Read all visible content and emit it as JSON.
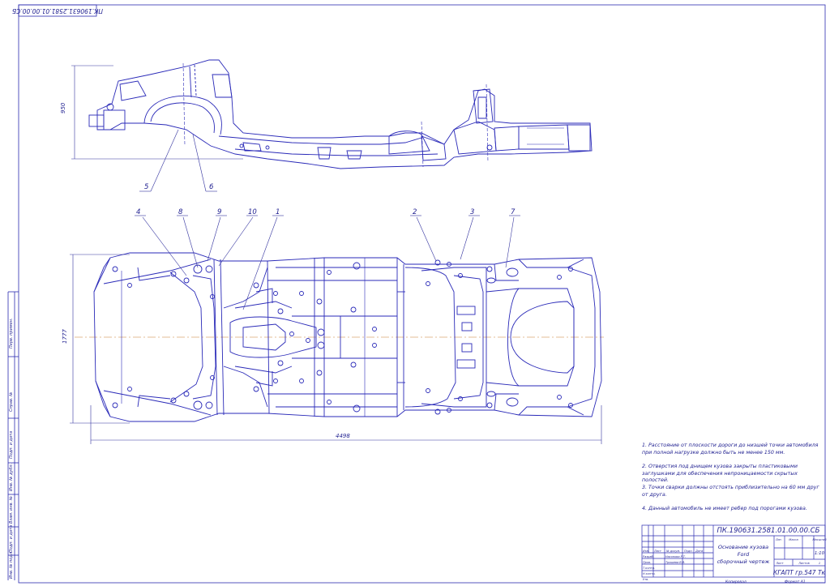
{
  "drawing": {
    "rotated_code": "ПК.190631.2581.01.00.00.СБ",
    "dimensions": {
      "height": "950",
      "width": "1777",
      "length": "4498"
    },
    "callouts_side": [
      "5",
      "6"
    ],
    "callouts_plan": [
      "4",
      "8",
      "9",
      "10",
      "1",
      "2",
      "3",
      "7"
    ]
  },
  "notes": [
    "1. Расстояние от плоскости дороги до низшей точки автомобиля при полной нагрузке должно быть не менее 150 мм.",
    "2. Отверстия под днищем кузова закрыты пластиковыми заглушками для обеспечения непроницаемости скрытых полостей.",
    "3. Точки сварки должны отстоять приблизительно на 60 мм друг от друга.",
    "4. Данный автомобиль не имеет ребер под порогами кузова."
  ],
  "title_block": {
    "code": "ПК.190631.2581.01.00.00.СБ",
    "name_line1": "Основание кузова",
    "name_line2": "Ford",
    "name_line3": "сборочный чертеж",
    "group": "КГАПТ гр.547 Тк",
    "lit_label": "Лит.",
    "mass_label": "Масса",
    "scale_label": "Масштаб",
    "scale": "1:10",
    "sheet_label": "Лист",
    "sheets_label": "Листов",
    "sheets_count": "1",
    "rows": [
      "Изм.",
      "Лист",
      "№ докум.",
      "Подп.",
      "Дата"
    ],
    "role_razrab": "Разраб.",
    "role_prov": "Пров.",
    "role_tkontr": "Т.контр.",
    "role_nkontr": "Н.контр.",
    "role_utv": "Утв.",
    "name_razrab": "Насонова Р.Т.",
    "name_prov": "Тришева В.В."
  },
  "footer": {
    "copied": "Копировал",
    "format": "Формат  А1"
  },
  "left_strip": [
    "Перв. примен.",
    "Справ. №",
    "Подп. и дата",
    "Инв. № дубл.",
    "Взам. инв. №",
    "Подп. и дата",
    "Инв. № подл."
  ]
}
